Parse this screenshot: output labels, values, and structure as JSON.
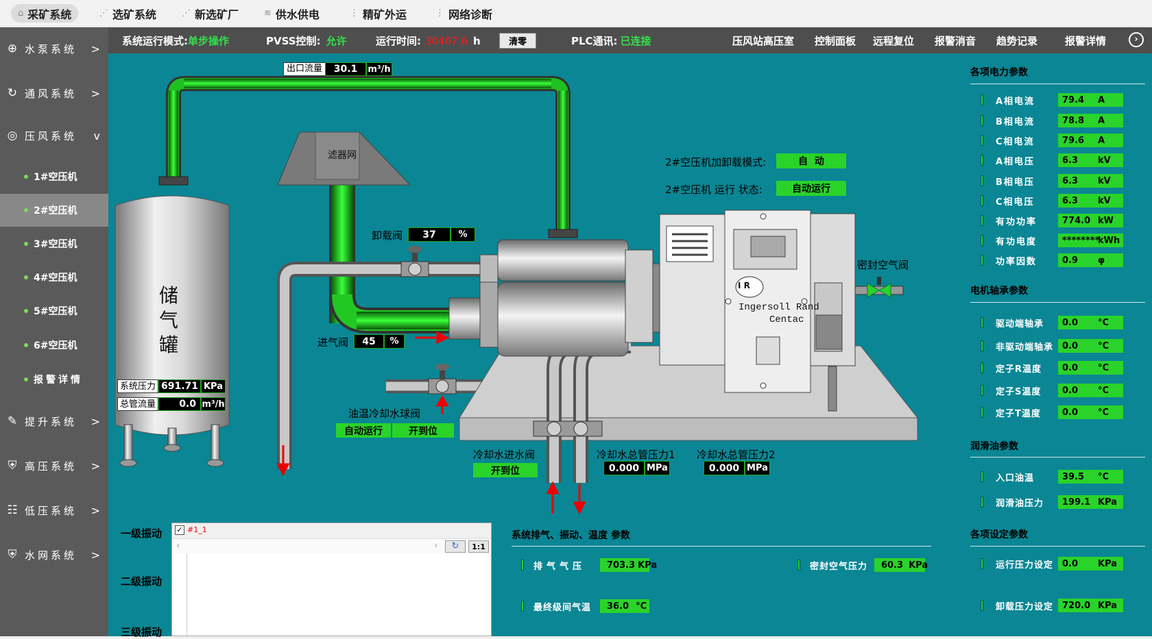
{
  "top_nav": [
    {
      "label": "采矿系统",
      "icon": "home-icon",
      "active": true
    },
    {
      "label": "选矿系统",
      "icon": "share-icon"
    },
    {
      "label": "新选矿厂",
      "icon": "share-icon"
    },
    {
      "label": "供水供电",
      "icon": "wifi-icon"
    },
    {
      "label": "精矿外运",
      "icon": "list-icon"
    },
    {
      "label": "网络诊断",
      "icon": "list-icon"
    }
  ],
  "sidebar": {
    "groups": [
      {
        "label": "水泵系统",
        "icon": "globe-icon",
        "chev": ">"
      },
      {
        "label": "通风系统",
        "icon": "refresh-icon",
        "chev": ">"
      },
      {
        "label": "压风系统",
        "icon": "location-icon",
        "chev": "v"
      },
      {
        "label": "提升系统",
        "icon": "edit-icon",
        "chev": ">"
      },
      {
        "label": "高压系统",
        "icon": "shield-icon",
        "chev": ">"
      },
      {
        "label": "低压系统",
        "icon": "grid-icon",
        "chev": ">"
      },
      {
        "label": "水网系统",
        "icon": "shield-icon",
        "chev": ">"
      }
    ],
    "sub_items": [
      "1#空压机",
      "2#空压机",
      "3#空压机",
      "4#空压机",
      "5#空压机",
      "6#空压机",
      "报警详情"
    ]
  },
  "status": {
    "mode_label": "系统运行模式:",
    "mode_value": "单步操作",
    "pvss_label": "PVSS控制:",
    "pvss_value": "允许",
    "runtime_label": "运行时间:",
    "runtime_value": "30407.6",
    "runtime_unit": "h",
    "clear_btn": "清零",
    "plc_label": "PLC通讯:",
    "plc_value": "已连接",
    "links": [
      "压风站高压室",
      "控制面板",
      "远程复位",
      "报警消音",
      "趋势记录",
      "报警详情"
    ]
  },
  "process": {
    "outlet_flow_label": "出口流量",
    "outlet_flow_value": "30.1",
    "outlet_flow_unit": "m³/h",
    "filter_label": "滤器网",
    "tank_label": [
      "储",
      "气",
      "罐"
    ],
    "sys_pressure_label": "系统压力",
    "sys_pressure_value": "691.71",
    "sys_pressure_unit": "KPa",
    "main_flow_label": "总管流量",
    "main_flow_value": "0.0",
    "main_flow_unit": "m³/h",
    "unload_valve_label": "卸载阀",
    "unload_valve_value": "37",
    "unload_valve_unit": "%",
    "inlet_valve_label": "进气阀",
    "inlet_valve_value": "45",
    "inlet_valve_unit": "%",
    "load_mode_label": "2#空压机加卸载模式:",
    "load_mode_value": "自  动",
    "run_state_label": "2#空压机  运行 状态:",
    "run_state_value": "自动运行",
    "seal_valve_label": "密封空气阀",
    "oil_cool_label": "油温冷却水球阀",
    "oil_cool_state1": "自动运行",
    "oil_cool_state2": "开到位",
    "cool_in_label": "冷却水进水阀",
    "cool_in_state": "开到位",
    "cool_p1_label": "冷却水总管压力1",
    "cool_p1_value": "0.000",
    "cool_p1_unit": "MPa",
    "cool_p2_label": "冷却水总管压力2",
    "cool_p2_value": "0.000",
    "cool_p2_unit": "MPa",
    "brand_line1": "Ingersoll Rand",
    "brand_line2": "Centac",
    "logo": "I R"
  },
  "vibration": {
    "labels": [
      "一级振动",
      "二级振动",
      "三级振动"
    ],
    "legend": "#1_1",
    "zoom_btn": "1:1"
  },
  "exhaust": {
    "title": "系统排气、振动、温度 参数",
    "rows": [
      {
        "name": "排气气压",
        "value": "703.3",
        "unit": "KPa"
      },
      {
        "name": "最终级间气温",
        "value": "36.0",
        "unit": "°C"
      },
      {
        "name": "密封空气压力",
        "value": "60.3",
        "unit": "KPa"
      }
    ]
  },
  "right_panel": {
    "power_title": "各项电力参数",
    "power": [
      {
        "name": "A相电流",
        "value": "79.4",
        "unit": "A"
      },
      {
        "name": "B相电流",
        "value": "78.8",
        "unit": "A"
      },
      {
        "name": "C相电流",
        "value": "79.6",
        "unit": "A"
      },
      {
        "name": "A相电压",
        "value": "6.3",
        "unit": "kV"
      },
      {
        "name": "B相电压",
        "value": "6.3",
        "unit": "kV"
      },
      {
        "name": "C相电压",
        "value": "6.3",
        "unit": "kV"
      },
      {
        "name": "有功功率",
        "value": "774.0",
        "unit": "kW"
      },
      {
        "name": "有功电度",
        "value": "********",
        "unit": "kWh"
      },
      {
        "name": "功率因数",
        "value": "0.9",
        "unit": "φ"
      }
    ],
    "bearing_title": "电机轴承参数",
    "bearing": [
      {
        "name": "驱动端轴承",
        "value": "0.0",
        "unit": "°C"
      },
      {
        "name": "非驱动端轴承",
        "value": "0.0",
        "unit": "°C"
      },
      {
        "name": "定子R温度",
        "value": "0.0",
        "unit": "°C"
      },
      {
        "name": "定子S温度",
        "value": "0.0",
        "unit": "°C"
      },
      {
        "name": "定子T温度",
        "value": "0.0",
        "unit": "°C"
      }
    ],
    "oil_title": "润滑油参数",
    "oil": [
      {
        "name": "入口油温",
        "value": "39.5",
        "unit": "°C"
      },
      {
        "name": "润滑油压力",
        "value": "199.1",
        "unit": "KPa"
      }
    ],
    "setting_title": "各项设定参数",
    "setting": [
      {
        "name": "运行压力设定",
        "value": "0.0",
        "unit": "KPa"
      },
      {
        "name": "卸载压力设定",
        "value": "720.0",
        "unit": "KPa"
      }
    ]
  }
}
